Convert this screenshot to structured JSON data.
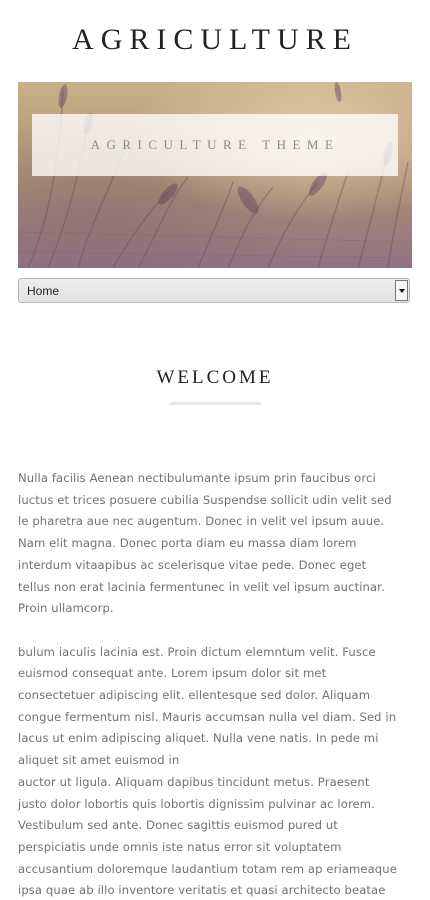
{
  "site": {
    "title": "AGRICULTURE"
  },
  "hero": {
    "banner_text": "AGRICULTURE THEME"
  },
  "nav": {
    "selected": "Home"
  },
  "section": {
    "heading": "WELCOME"
  },
  "paragraphs": [
    [
      "Nulla facilis Aenean nectibulumante ipsum prin faucibus orci",
      "luctus et trices posuere cubilia Suspendse sollicit udin velit sed",
      "le pharetra aue nec augentum. Donec in velit vel ipsum auue.",
      "Nam elit magna. Donec porta diam eu massa diam lorem",
      "interdum vitaapibus ac scelerisque vitae pede. Donec eget",
      "tellus non erat lacinia fermentunec in velit vel ipsum auctinar.",
      "Proin ullamcorp."
    ],
    [
      "bulum iaculis lacinia est. Proin dictum elemntum velit. Fusce",
      "euismod consequat ante. Lorem ipsum dolor sit met",
      "consectetuer adipiscing elit. ellentesque sed dolor. Aliquam",
      "congue fermentum nisl. Mauris accumsan nulla vel diam. Sed in",
      "lacus ut enim adipiscing aliquet. Nulla vene natis. In pede mi",
      "aliquet sit amet euismod in",
      "auctor ut ligula. Aliquam dapibus tincidunt metus. Praesent",
      "justo dolor lobortis quis lobortis dignissim pulvinar ac lorem.",
      "Vestibulum sed ante. Donec sagittis euismod pured ut",
      "perspiciatis unde omnis iste natus error sit voluptatem",
      "accusantium doloremque laudantium totam rem ap eriameaque",
      "ipsa quae ab illo inventore veritatis et quasi architecto beatae"
    ]
  ],
  "icons": {
    "select_arrow": "chevron-down-icon"
  }
}
